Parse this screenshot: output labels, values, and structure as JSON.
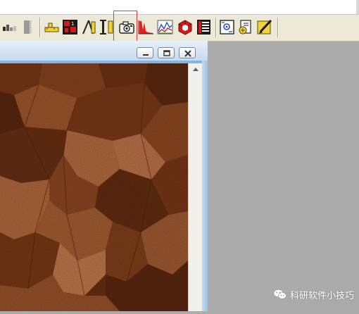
{
  "toolbar": {
    "buttons": [
      {
        "icon": "histogram-mode-icon"
      },
      {
        "icon": "scroll-gauge-icon"
      },
      {
        "icon": "measure-lengths-icon"
      },
      {
        "icon": "segmentation-icon"
      },
      {
        "icon": "caliper-icon"
      },
      {
        "icon": "thickness-icon"
      },
      {
        "icon": "camera-capture-icon"
      },
      {
        "icon": "histogram-icon"
      },
      {
        "icon": "line-profile-icon"
      },
      {
        "icon": "3d-surface-icon"
      },
      {
        "icon": "data-table-icon"
      },
      {
        "icon": "macro-icon"
      },
      {
        "icon": "plugin-icon"
      },
      {
        "icon": "macro-edit-icon"
      }
    ],
    "highlighted_button": "camera-capture-icon",
    "highlight_color": "#e53935"
  },
  "child_window": {
    "controls": [
      "minimize-icon",
      "restore-icon",
      "close-icon"
    ],
    "image": "micrograph-grain-structure"
  },
  "watermark": {
    "text": "科研软件小技巧",
    "icon": "wechat-icon"
  },
  "colors": {
    "workspace": "#ababab",
    "toolbar": "#ece9d8",
    "window_frame": "#7fb8e8",
    "micrograph_dark": "#6b2f12",
    "micrograph_light": "#c0744a"
  }
}
